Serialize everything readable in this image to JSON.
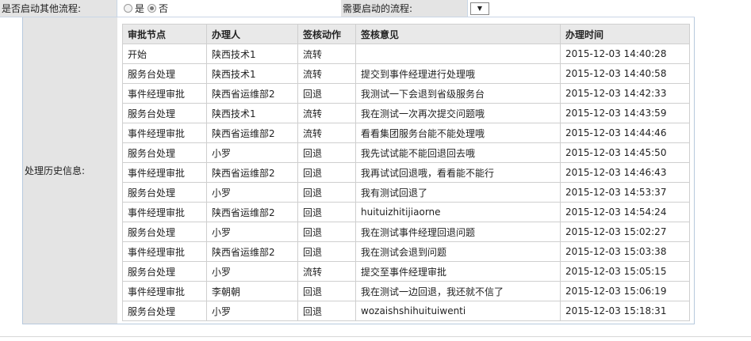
{
  "top": {
    "start_other_label": "是否启动其他流程:",
    "radio_yes": "是",
    "radio_no": "否",
    "need_start_label": "需要启动的流程:",
    "select_arrow": "▼"
  },
  "history": {
    "label": "处理历史信息:",
    "headers": [
      "审批节点",
      "办理人",
      "签核动作",
      "签核意见",
      "办理时间"
    ],
    "rows": [
      [
        "开始",
        "陕西技术1",
        "流转",
        "",
        "2015-12-03 14:40:28"
      ],
      [
        "服务台处理",
        "陕西技术1",
        "流转",
        "提交到事件经理进行处理哦",
        "2015-12-03 14:40:58"
      ],
      [
        "事件经理审批",
        "陕西省运维部2",
        "回退",
        "我测试一下会退到省级服务台",
        "2015-12-03 14:42:33"
      ],
      [
        "服务台处理",
        "陕西技术1",
        "流转",
        "我在测试一次再次提交问题哦",
        "2015-12-03 14:43:59"
      ],
      [
        "事件经理审批",
        "陕西省运维部2",
        "流转",
        "看看集团服务台能不能处理哦",
        "2015-12-03 14:44:46"
      ],
      [
        "服务台处理",
        "小罗",
        "回退",
        "我先试试能不能回退回去哦",
        "2015-12-03 14:45:50"
      ],
      [
        "事件经理审批",
        "陕西省运维部2",
        "回退",
        "我再试试回退哦，看看能不能行",
        "2015-12-03 14:46:43"
      ],
      [
        "服务台处理",
        "小罗",
        "回退",
        "我有测试回退了",
        "2015-12-03 14:53:37"
      ],
      [
        "事件经理审批",
        "陕西省运维部2",
        "回退",
        "huituizhitijiaorne",
        "2015-12-03 14:54:24"
      ],
      [
        "服务台处理",
        "小罗",
        "回退",
        "我在测试事件经理回退问题",
        "2015-12-03 15:02:27"
      ],
      [
        "事件经理审批",
        "陕西省运维部2",
        "回退",
        "我在测试会退到问题",
        "2015-12-03 15:03:38"
      ],
      [
        "服务台处理",
        "小罗",
        "流转",
        "提交至事件经理审批",
        "2015-12-03 15:05:15"
      ],
      [
        "事件经理审批",
        "李朝朝",
        "回退",
        "我在测试一边回退，我还就不信了",
        "2015-12-03 15:06:19"
      ],
      [
        "服务台处理",
        "小罗",
        "回退",
        "wozaishshihuituiwenti",
        "2015-12-03 15:18:31"
      ]
    ]
  }
}
